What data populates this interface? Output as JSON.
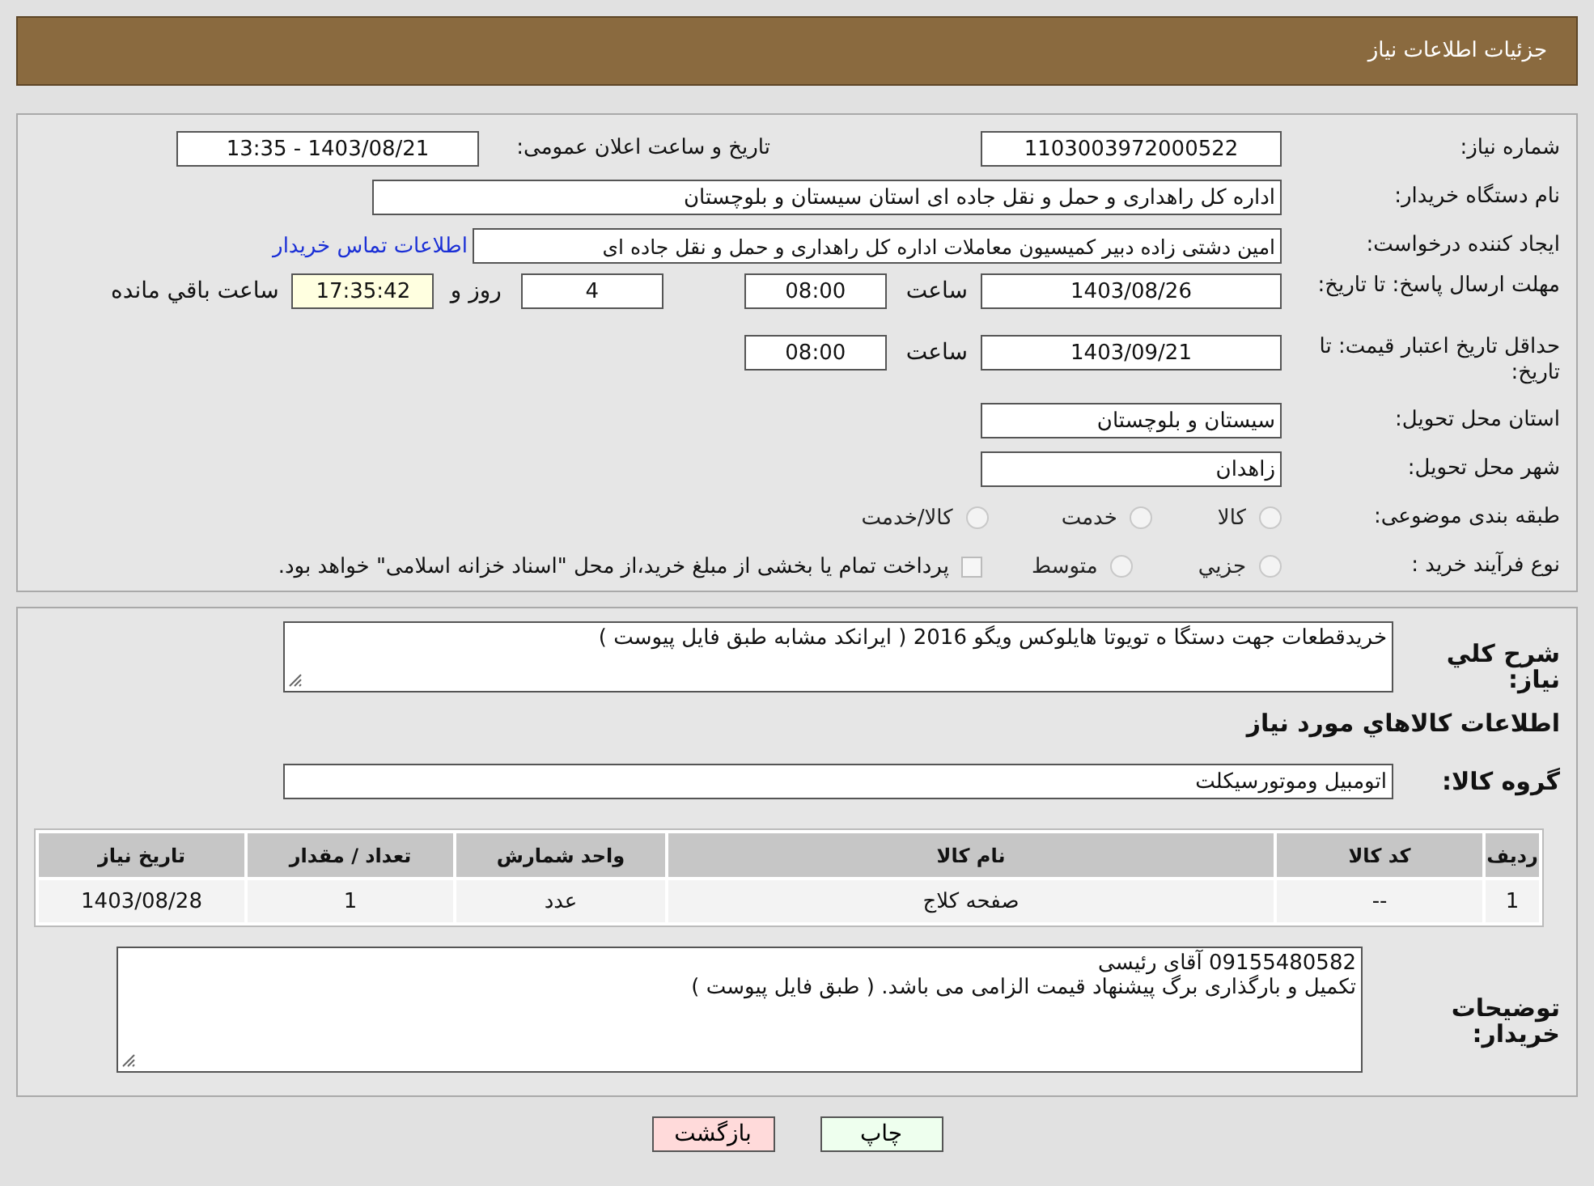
{
  "header": {
    "title": "جزئیات اطلاعات نیاز"
  },
  "need_number": {
    "label": "شماره نیاز:",
    "value": "1103003972000522"
  },
  "announce": {
    "label": "تاریخ و ساعت اعلان عمومی:",
    "value": "1403/08/21 - 13:35"
  },
  "buyer_org": {
    "label": "نام دستگاه خریدار:",
    "value": "اداره کل راهداری و حمل و نقل جاده ای استان سیستان و بلوچستان"
  },
  "creator": {
    "label": "ایجاد کننده درخواست:",
    "value": "امین دشتی زاده دبیر کمیسیون معاملات اداره کل راهداری و حمل و نقل جاده ای",
    "link": "اطلاعات تماس خریدار"
  },
  "deadline": {
    "label": "مهلت ارسال پاسخ: تا تاریخ:",
    "date": "1403/08/26",
    "time_label": "ساعت",
    "time": "08:00",
    "days": "4",
    "days_label": "روز و",
    "remaining": "17:35:42",
    "remaining_label": "ساعت باقي مانده"
  },
  "validity": {
    "label": "حداقل تاریخ اعتبار قیمت: تا تاریخ:",
    "date": "1403/09/21",
    "time_label": "ساعت",
    "time": "08:00"
  },
  "province": {
    "label": "استان محل تحویل:",
    "value": "سیستان و بلوچستان"
  },
  "city": {
    "label": "شهر محل تحویل:",
    "value": "زاهدان"
  },
  "category": {
    "label": "طبقه بندی موضوعی:",
    "options": [
      {
        "label": "کالا",
        "selected": false,
        "disabled": true
      },
      {
        "label": "خدمت",
        "selected": false,
        "disabled": true
      },
      {
        "label": "کالا/خدمت",
        "selected": false,
        "disabled": true
      }
    ]
  },
  "purchase_type": {
    "label": "نوع فرآیند خرید :",
    "options": [
      {
        "label": "جزيي",
        "selected": false,
        "disabled": true
      },
      {
        "label": "متوسط",
        "selected": false,
        "disabled": true
      }
    ],
    "payment": {
      "label": "پرداخت تمام یا بخشی از مبلغ خرید،از محل \"اسناد خزانه اسلامی\" خواهد بود.",
      "checked": false
    }
  },
  "description": {
    "label": "شرح کلي نياز:",
    "value": "خریدقطعات جهت دستگا ه تویوتا هایلوکس ویگو 2016 ( ایرانکد مشابه طبق فایل پیوست )"
  },
  "goods_title": "اطلاعات کالاهاي مورد نياز",
  "goods_group": {
    "label": "گروه کالا:",
    "value": "اتومبیل وموتورسیکلت"
  },
  "table": {
    "columns": [
      "ردیف",
      "کد کالا",
      "نام کالا",
      "واحد شمارش",
      "تعداد / مقدار",
      "تاریخ نیاز"
    ],
    "rows": [
      [
        "1",
        "--",
        "صفحه کلاج",
        "عدد",
        "1",
        "1403/08/28"
      ]
    ]
  },
  "buyer_notes": {
    "label": "توضیحات خریدار:",
    "lines": [
      "09155480582 آقای رئیسی",
      "تکمیل و بارگذاری برگ پیشنهاد قیمت الزامی می باشد. ( طبق فایل پیوست )"
    ]
  },
  "buttons": [
    {
      "label": "چاپ",
      "kind": "print"
    },
    {
      "label": "بازگشت",
      "kind": "back"
    }
  ]
}
